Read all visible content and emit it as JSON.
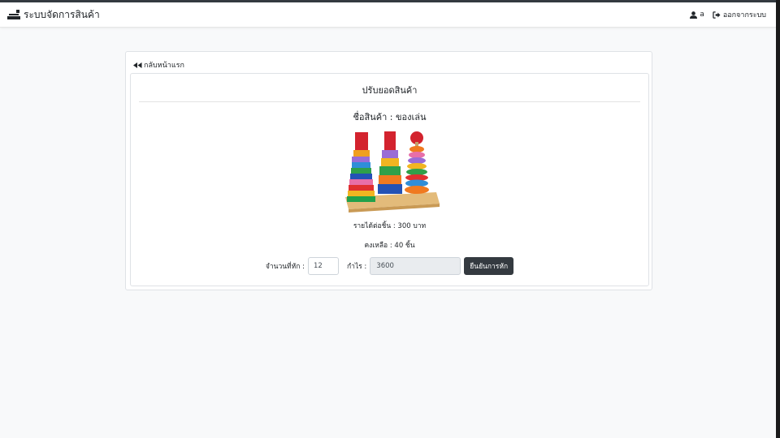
{
  "navbar": {
    "brand": "ระบบจัดการสินค้า",
    "user_label": "a",
    "logout_label": "ออกจากระบบ"
  },
  "card": {
    "back_label": "กลับหน้าแรก",
    "title": "ปรับยอดสินค้า",
    "product_name": "ชื่อสินค้า : ของเล่น",
    "income_per_piece": "รายได้ต่อชิ้น : 300 บาท",
    "remaining": "คงเหลือ : 40 ชิ้น",
    "form": {
      "qty_label": "จำนวนที่หัก :",
      "qty_value": "12",
      "profit_label": "กำไร :",
      "profit_value": "3600",
      "confirm_label": "ยืนยันการหัก"
    }
  },
  "icons": {
    "brand": "warehouse-icon",
    "user": "user-icon",
    "logout": "sign-out-icon",
    "back": "backward-icon"
  },
  "colors": {
    "navbar_bg": "#ffffff",
    "page_bg": "#f8f9fa",
    "button_bg": "#343a40",
    "readonly_bg": "#e9ecef"
  }
}
